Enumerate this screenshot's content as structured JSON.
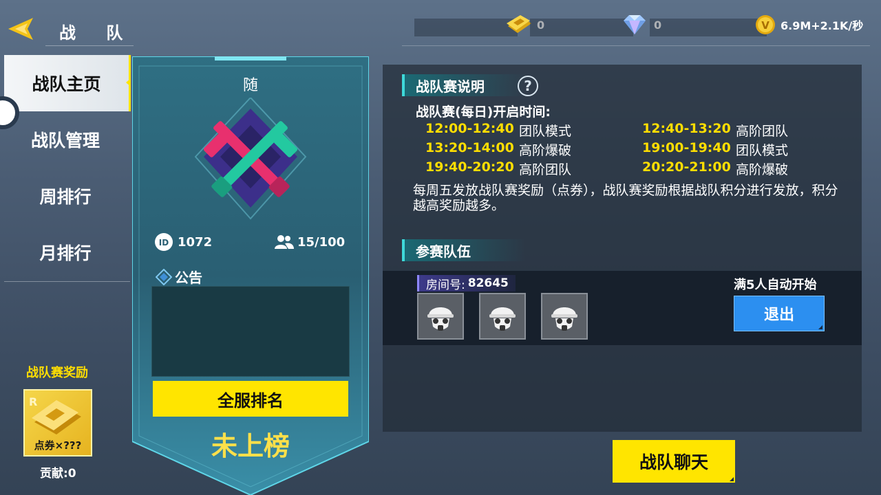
{
  "header": {
    "title": "战 队",
    "resources": {
      "voucher": "0",
      "diamond": "0",
      "coin": "6.9M+2.1K/秒"
    }
  },
  "nav": {
    "items": [
      {
        "label": "战队主页",
        "active": true
      },
      {
        "label": "战队管理",
        "active": false
      },
      {
        "label": "周排行",
        "active": false
      },
      {
        "label": "月排行",
        "active": false
      }
    ]
  },
  "reward": {
    "title": "战队赛奖励",
    "card_label": "点券×???",
    "contribution": "贡献:0"
  },
  "team": {
    "initial": "随",
    "id": "1072",
    "members": "15/100",
    "notice_title": "公告",
    "notice_text": "",
    "rank_button": "全服排名",
    "rank_status": "未上榜"
  },
  "rules": {
    "title": "战队赛说明",
    "help": "?",
    "open_time_label": "战队赛(每日)开启时间:",
    "schedule": [
      {
        "time": "12:00-12:40",
        "mode": "团队模式"
      },
      {
        "time": "12:40-13:20",
        "mode": "高阶团队"
      },
      {
        "time": "13:20-14:00",
        "mode": "高阶爆破"
      },
      {
        "time": "19:00-19:40",
        "mode": "团队模式"
      },
      {
        "time": "19:40-20:20",
        "mode": "高阶团队"
      },
      {
        "time": "20:20-21:00",
        "mode": "高阶爆破"
      }
    ],
    "description": "每周五发放战队赛奖励（点券），战队赛奖励根据战队积分进行发放，积分越高奖励越多。"
  },
  "teams": {
    "title": "参赛队伍",
    "room_label": "房间号:",
    "room_number": "82645",
    "auto_start": "满5人自动开始",
    "exit_button": "退出"
  },
  "chat_button": "战队聊天",
  "colors": {
    "accent_yellow": "#ffe500",
    "time_yellow": "#ffde00",
    "exit_blue": "#2c8ff0",
    "section_cyan": "#3fd9d9"
  }
}
